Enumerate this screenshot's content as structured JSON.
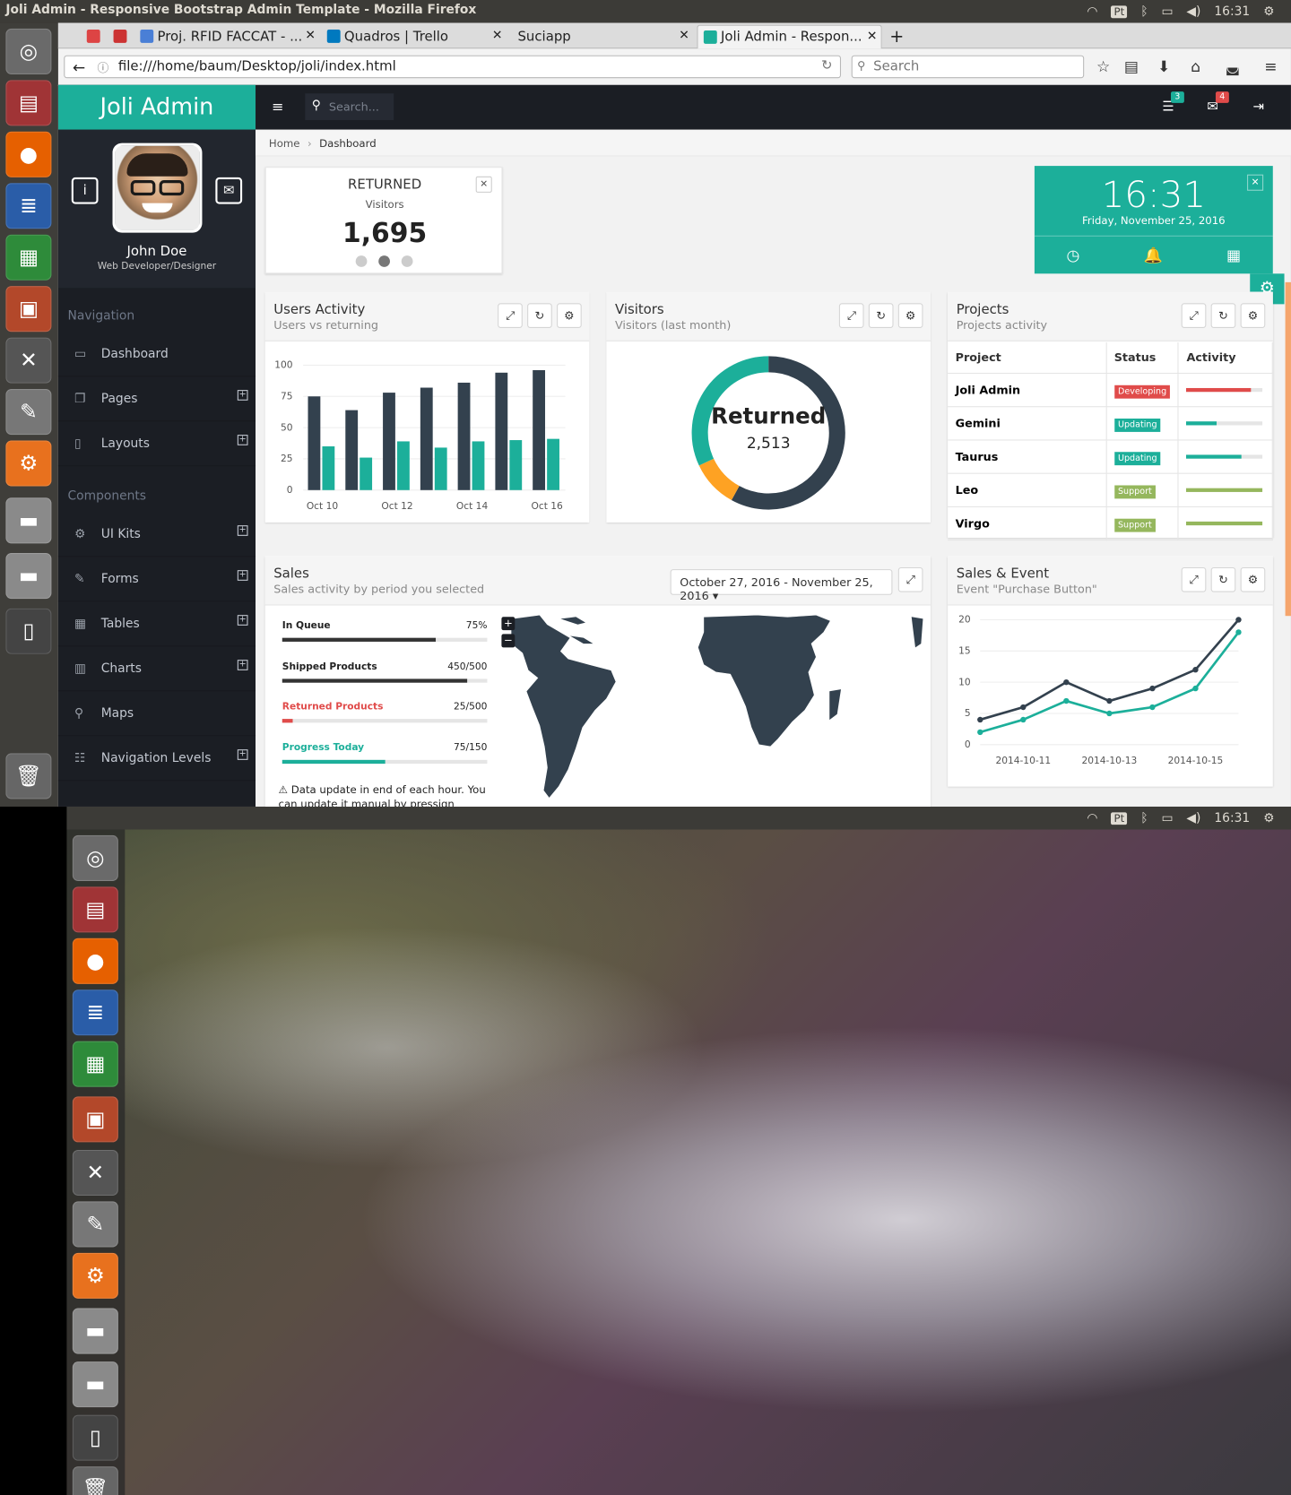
{
  "os": {
    "window_title": "Joli Admin - Responsive Bootstrap Admin Template - Mozilla Firefox",
    "clock": "16:31",
    "keyboard": "Pt"
  },
  "browser": {
    "tabs": [
      {
        "label": "Proj. RFID FACCAT - ...",
        "icon": "docs-icon"
      },
      {
        "label": "Quadros | Trello",
        "icon": "trello-icon"
      },
      {
        "label": "Suciapp",
        "icon": ""
      },
      {
        "label": "Joli Admin - Respon...",
        "icon": "joli-icon"
      }
    ],
    "url": "file:///home/baum/Desktop/joli/index.html",
    "search_placeholder": "Search"
  },
  "app": {
    "brand": "Joli Admin",
    "search_placeholder": "Search...",
    "tasks_badge": "3",
    "messages_badge": "4",
    "profile": {
      "name": "John Doe",
      "role": "Web Developer/Designer"
    },
    "nav_title": "Navigation",
    "components_title": "Components",
    "nav": [
      "Dashboard",
      "Pages",
      "Layouts"
    ],
    "components": [
      "UI Kits",
      "Forms",
      "Tables",
      "Charts",
      "Maps",
      "Navigation Levels"
    ],
    "breadcrumb": {
      "home": "Home",
      "current": "Dashboard"
    },
    "returned": {
      "title": "RETURNED",
      "sub": "Visitors",
      "value": "1,695"
    },
    "clock": {
      "time": "16:31",
      "date": "Friday, November 25, 2016"
    },
    "users_activity": {
      "title": "Users Activity",
      "sub": "Users vs returning"
    },
    "visitors": {
      "title": "Visitors",
      "sub": "Visitors (last month)",
      "center_title": "Returned",
      "center_value": "2,513"
    },
    "projects": {
      "title": "Projects",
      "sub": "Projects activity",
      "headers": [
        "Project",
        "Status",
        "Activity"
      ],
      "rows": [
        {
          "name": "Joli Admin",
          "status": "Developing",
          "color": "#e04b4a",
          "activity": 0.85
        },
        {
          "name": "Gemini",
          "status": "Updating",
          "color": "#1caf9a",
          "activity": 0.4
        },
        {
          "name": "Taurus",
          "status": "Updating",
          "color": "#1caf9a",
          "activity": 0.72
        },
        {
          "name": "Leo",
          "status": "Support",
          "color": "#95b75d",
          "activity": 1.0
        },
        {
          "name": "Virgo",
          "status": "Support",
          "color": "#95b75d",
          "activity": 1.0
        }
      ]
    },
    "sales": {
      "title": "Sales",
      "sub": "Sales activity by period you selected",
      "range": "October 27, 2016 - November 25, 2016",
      "progress": [
        {
          "label": "In Queue",
          "value": "75%",
          "frac": 0.75,
          "color": "#333333",
          "label_color": "#222222"
        },
        {
          "label": "Shipped Products",
          "value": "450/500",
          "frac": 0.9,
          "color": "#333333",
          "label_color": "#222222"
        },
        {
          "label": "Returned Products",
          "value": "25/500",
          "frac": 0.05,
          "color": "#e04b4a",
          "label_color": "#e04b4a"
        },
        {
          "label": "Progress Today",
          "value": "75/150",
          "frac": 0.5,
          "color": "#1caf9a",
          "label_color": "#1caf9a"
        }
      ],
      "note": "Data update in end of each hour. You can update it manual by pressign update"
    },
    "sales_event": {
      "title": "Sales & Event",
      "sub": "Event \"Purchase Button\""
    }
  },
  "chart_data": [
    {
      "type": "bar",
      "title": "Users Activity",
      "categories": [
        "Oct 10",
        "Oct 11",
        "Oct 12",
        "Oct 13",
        "Oct 14",
        "Oct 15",
        "Oct 16"
      ],
      "tick_labels": [
        "Oct 10",
        "Oct 12",
        "Oct 14",
        "Oct 16"
      ],
      "series": [
        {
          "values": [
            75,
            64,
            78,
            82,
            86,
            94,
            96
          ],
          "color": "#33414e"
        },
        {
          "values": [
            35,
            26,
            39,
            34,
            39,
            40,
            41
          ],
          "color": "#1caf9a"
        }
      ],
      "ylim": [
        0,
        100
      ],
      "yticks": [
        0,
        25,
        50,
        75,
        100
      ]
    },
    {
      "type": "pie",
      "title": "Visitors",
      "slices": [
        {
          "value": 58,
          "color": "#33414e"
        },
        {
          "value": 10,
          "color": "#fea223"
        },
        {
          "value": 32,
          "color": "#1caf9a"
        }
      ]
    },
    {
      "type": "line",
      "title": "Sales & Event",
      "x": [
        "2014-10-10",
        "2014-10-11",
        "2014-10-12",
        "2014-10-13",
        "2014-10-14",
        "2014-10-15",
        "2014-10-16"
      ],
      "tick_labels": [
        "2014-10-11",
        "2014-10-13",
        "2014-10-15"
      ],
      "series": [
        {
          "values": [
            4,
            6,
            10,
            7,
            9,
            12,
            20
          ],
          "color": "#33414e"
        },
        {
          "values": [
            2,
            4,
            7,
            5,
            6,
            9,
            18
          ],
          "color": "#1caf9a"
        }
      ],
      "ylim": [
        0,
        20
      ],
      "yticks": [
        0,
        5,
        10,
        15,
        20
      ]
    }
  ]
}
